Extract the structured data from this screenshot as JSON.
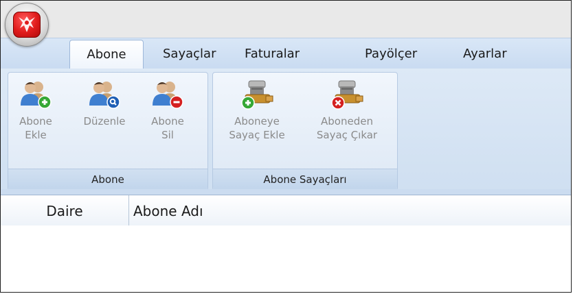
{
  "app": {
    "orb_icon": "app-logo-icon",
    "accent": "#e01b1b"
  },
  "tabs": [
    {
      "label": "Abone",
      "active": true
    },
    {
      "label": "Sayaçlar",
      "active": false
    },
    {
      "label": "Faturalar",
      "active": false
    },
    {
      "label": "Payölçer",
      "active": false
    },
    {
      "label": "Ayarlar",
      "active": false
    }
  ],
  "ribbon": {
    "groups": [
      {
        "label": "Abone",
        "buttons": [
          {
            "label": "Abone\nEkle",
            "icon": "users-add-icon",
            "enabled": false
          },
          {
            "label": "Düzenle",
            "icon": "users-search-icon",
            "enabled": false
          },
          {
            "label": "Abone\nSil",
            "icon": "users-remove-icon",
            "enabled": false
          }
        ]
      },
      {
        "label": "Abone Sayaçları",
        "buttons": [
          {
            "label": "Aboneye\nSayaç Ekle",
            "icon": "meter-add-icon",
            "enabled": false
          },
          {
            "label": "Aboneden\nSayaç Çıkar",
            "icon": "meter-remove-icon",
            "enabled": false
          }
        ]
      }
    ]
  },
  "grid": {
    "columns": [
      "Daire",
      "Abone Adı"
    ],
    "rows": []
  }
}
